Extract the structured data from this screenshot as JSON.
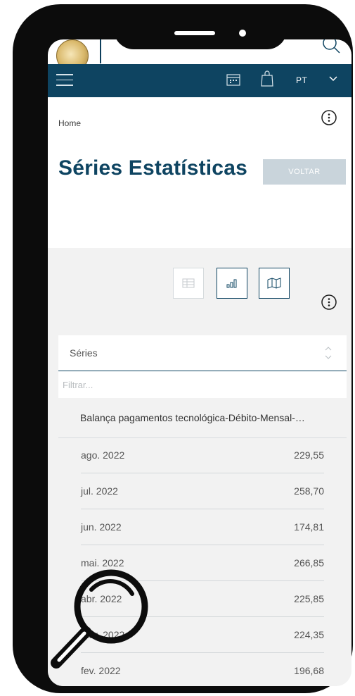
{
  "header": {
    "language": "PT"
  },
  "breadcrumb": {
    "home": "Home"
  },
  "page": {
    "title": "Séries Estatísticas",
    "back_label": "VOLTAR"
  },
  "series_panel": {
    "header_label": "Séries",
    "filter_placeholder": "Filtrar...",
    "series_name": "Balança pagamentos tecnológica-Débito-Mensal-…"
  },
  "rows": [
    {
      "date": "ago. 2022",
      "value": "229,55"
    },
    {
      "date": "jul. 2022",
      "value": "258,70"
    },
    {
      "date": "jun. 2022",
      "value": "174,81"
    },
    {
      "date": "mai. 2022",
      "value": "266,85"
    },
    {
      "date": "abr. 2022",
      "value": "225,85"
    },
    {
      "date": "mar. 2022",
      "value": "224,35"
    },
    {
      "date": "fev. 2022",
      "value": "196,68"
    }
  ],
  "colors": {
    "brand_navy": "#0e4461",
    "button_disabled": "#c9d4db",
    "section_gray": "#f2f2f2"
  }
}
